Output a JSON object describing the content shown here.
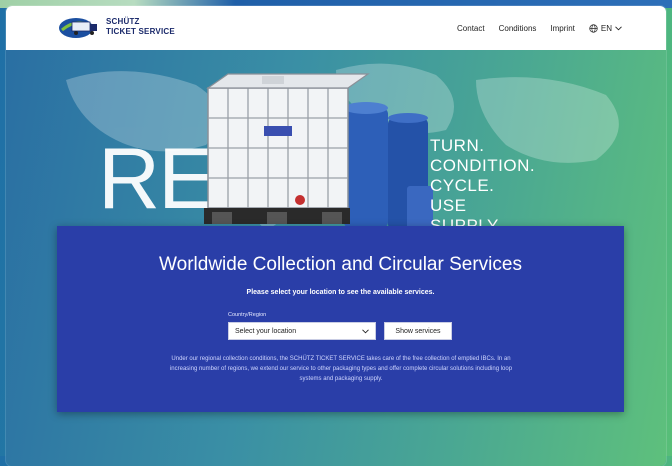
{
  "header": {
    "logo": {
      "line1": "SCHÜTZ",
      "line2": "TICKET SERVICE"
    },
    "nav": [
      {
        "label": "Contact"
      },
      {
        "label": "Conditions"
      },
      {
        "label": "Imprint"
      }
    ],
    "language": "EN"
  },
  "hero": {
    "big_text": "RE",
    "words": [
      "TURN.",
      "CONDITION.",
      "CYCLE.",
      "USE",
      "SUPPLY."
    ]
  },
  "panel": {
    "title": "Worldwide Collection and Circular Services",
    "subtitle": "Please select your location to see the available services.",
    "field_label": "Country/Region",
    "select_value": "Select your location",
    "button_label": "Show services",
    "description": "Under our regional collection conditions, the SCHÜTZ TICKET SERVICE takes care of the free collection of emptied IBCs. In an increasing number of regions, we extend our service to other packaging types and offer complete circular solutions including loop systems and packaging supply."
  },
  "colors": {
    "panel_bg": "#2a3ea8",
    "brand_navy": "#1b2a6b"
  },
  "icons": [
    "logo-truck-icon",
    "globe-icon",
    "chevron-down-icon"
  ]
}
